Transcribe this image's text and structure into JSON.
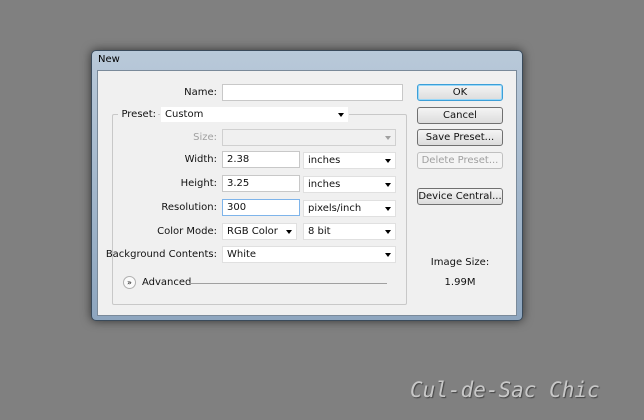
{
  "dialog": {
    "title": "New"
  },
  "form": {
    "name_label": "Name:",
    "name_value": "",
    "preset_label": "Preset:",
    "preset_value": "Custom",
    "size_label": "Size:",
    "size_value": "",
    "width_label": "Width:",
    "width_value": "2.38",
    "width_unit": "inches",
    "height_label": "Height:",
    "height_value": "3.25",
    "height_unit": "inches",
    "resolution_label": "Resolution:",
    "resolution_value": "300",
    "resolution_unit": "pixels/inch",
    "color_mode_label": "Color Mode:",
    "color_mode_value": "RGB Color",
    "bit_depth_value": "8 bit",
    "background_label": "Background Contents:",
    "background_value": "White",
    "advanced_label": "Advanced"
  },
  "buttons": {
    "ok": "OK",
    "cancel": "Cancel",
    "save_preset": "Save Preset...",
    "delete_preset": "Delete Preset...",
    "device_central": "Device Central..."
  },
  "image_size": {
    "label": "Image Size:",
    "value": "1.99M"
  },
  "watermark": "Cul-de-Sac Chic"
}
